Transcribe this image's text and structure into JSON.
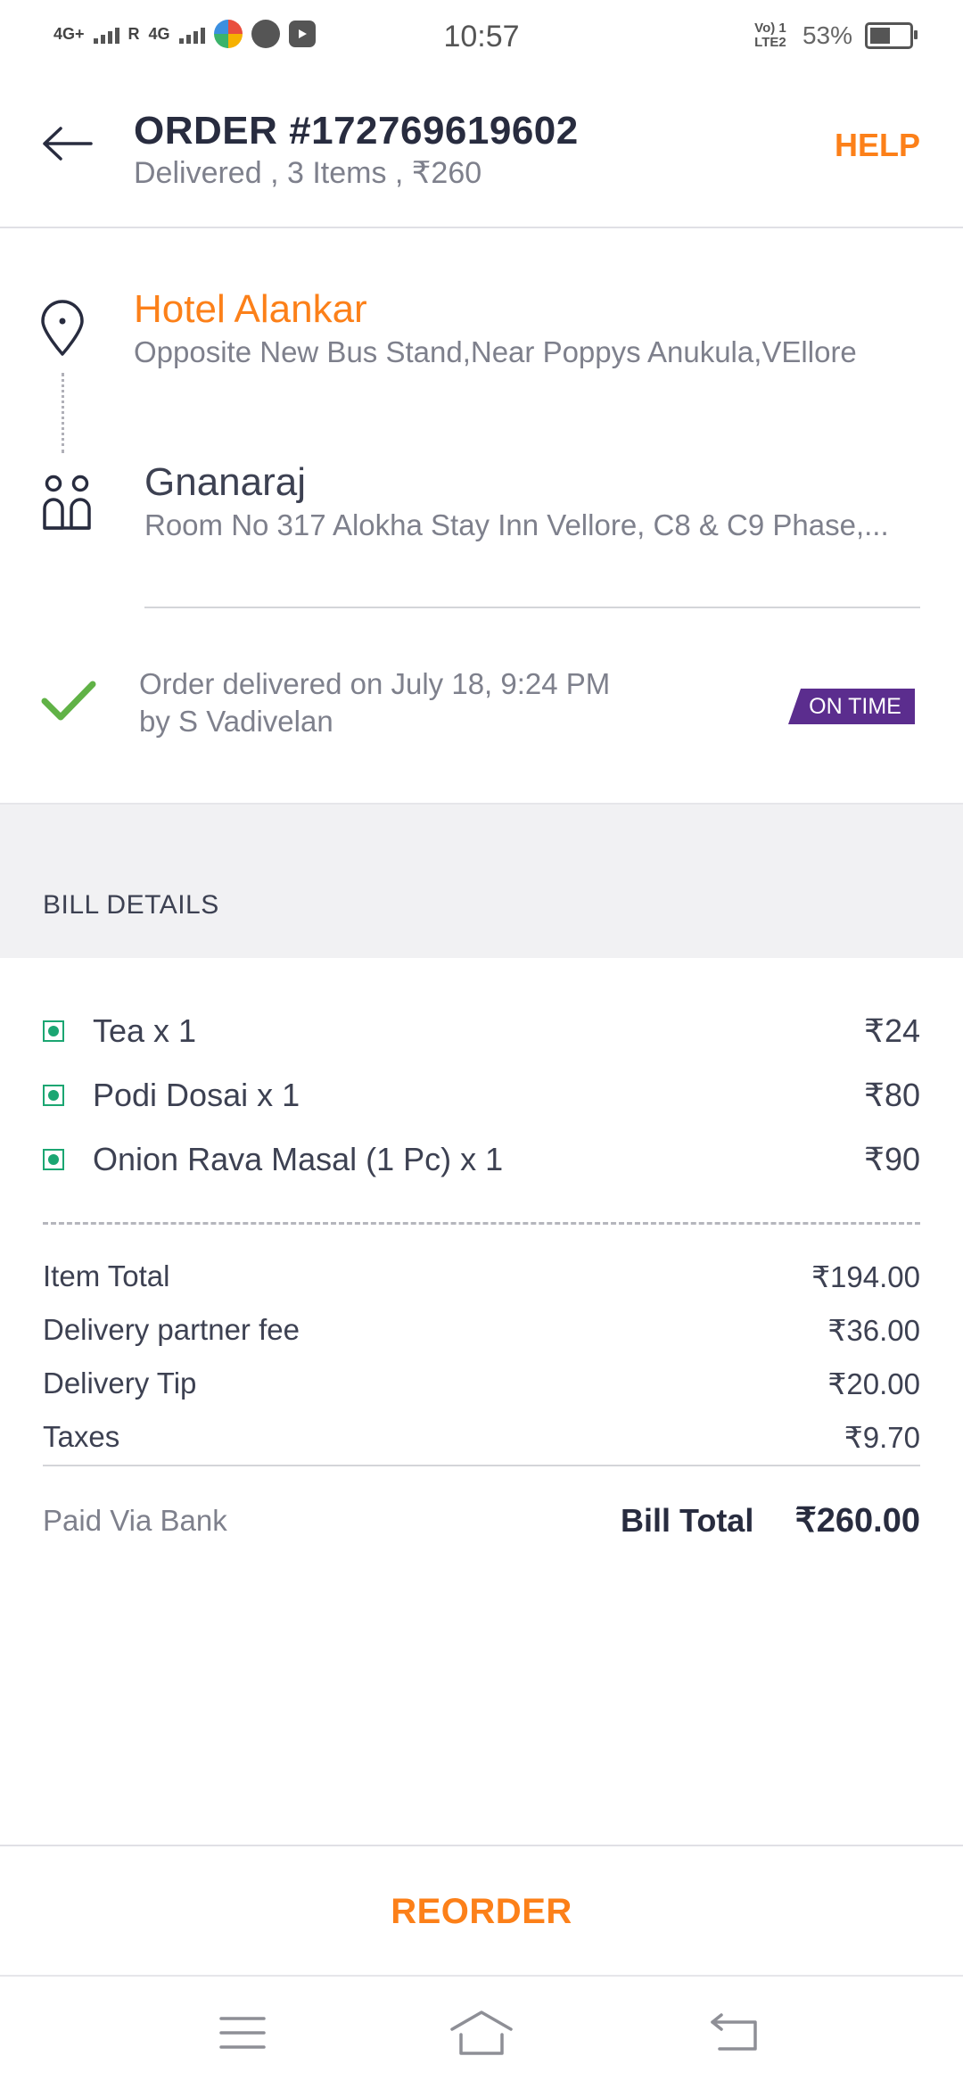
{
  "status_bar": {
    "time": "10:57",
    "network1": "4G+",
    "roaming": "R",
    "network2": "4G",
    "volte": "Vo) 1 LTE2",
    "battery": "53%",
    "battery_level": 0.53
  },
  "header": {
    "title": "ORDER #172769619602",
    "subtitle": "Delivered , 3 Items , ₹260",
    "help_label": "HELP"
  },
  "route": {
    "restaurant_name": "Hotel Alankar",
    "restaurant_address": "Opposite New Bus Stand,Near Poppys Anukula,VEllore",
    "customer_name": "Gnanaraj",
    "customer_address": "Room No 317 Alokha Stay Inn Vellore, C8 & C9 Phase,..."
  },
  "delivery": {
    "line1": "Order delivered on July 18, 9:24 PM",
    "line2": "by S Vadivelan",
    "badge": "ON TIME"
  },
  "bill": {
    "heading": "BILL DETAILS",
    "items": [
      {
        "name": "Tea x 1",
        "price": "₹24"
      },
      {
        "name": "Podi Dosai x 1",
        "price": "₹80"
      },
      {
        "name": "Onion Rava Masal (1 Pc) x 1",
        "price": "₹90"
      }
    ],
    "fees": [
      {
        "label": "Item Total",
        "value": "₹194.00"
      },
      {
        "label": "Delivery partner fee",
        "value": "₹36.00"
      },
      {
        "label": "Delivery Tip",
        "value": "₹20.00"
      },
      {
        "label": "Taxes",
        "value": "₹9.70"
      }
    ],
    "paid_via": "Paid Via Bank",
    "total_label": "Bill Total",
    "total_value": "₹260.00"
  },
  "footer": {
    "reorder_label": "REORDER"
  },
  "colors": {
    "accent": "#fc8019",
    "badge": "#5b2d8e",
    "check": "#60b246",
    "veg": "#1ba672"
  }
}
